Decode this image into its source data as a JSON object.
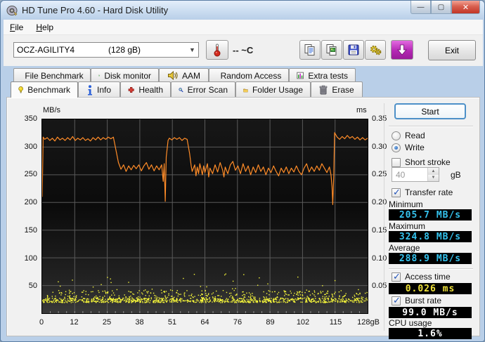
{
  "window": {
    "title": "HD Tune Pro 4.60 - Hard Disk Utility",
    "controls": {
      "minimize": "—",
      "maximize": "▢",
      "close": "✕"
    }
  },
  "menu": {
    "file": "File",
    "help": "Help"
  },
  "toolbar": {
    "drive_selector": {
      "name": "OCZ-AGILITY4",
      "size": "(128 gB)"
    },
    "temperature": "-- ~C",
    "icons": [
      "thermometer-icon",
      "copy-text-icon",
      "copy-image-icon",
      "save-icon",
      "options-gears-icon",
      "download-icon"
    ],
    "exit_label": "Exit"
  },
  "tabs": {
    "top": [
      {
        "label": "File Benchmark",
        "icon": "file-benchmark-icon"
      },
      {
        "label": "Disk monitor",
        "icon": "disk-monitor-icon"
      },
      {
        "label": "AAM",
        "icon": "speaker-icon"
      },
      {
        "label": "Random Access",
        "icon": "random-access-icon"
      },
      {
        "label": "Extra tests",
        "icon": "extra-tests-icon"
      }
    ],
    "bottom": [
      {
        "label": "Benchmark",
        "icon": "lightbulb-icon",
        "active": true
      },
      {
        "label": "Info",
        "icon": "info-icon",
        "active": false
      },
      {
        "label": "Health",
        "icon": "health-cross-icon",
        "active": false
      },
      {
        "label": "Error Scan",
        "icon": "magnifier-icon",
        "active": false
      },
      {
        "label": "Folder Usage",
        "icon": "folder-icon",
        "active": false
      },
      {
        "label": "Erase",
        "icon": "trash-icon",
        "active": false
      }
    ]
  },
  "benchmark_panel": {
    "start_label": "Start",
    "mode": {
      "read_label": "Read",
      "write_label": "Write",
      "selected": "Write"
    },
    "short_stroke": {
      "label": "Short stroke",
      "checked": false,
      "size_value": "40",
      "size_unit": "gB"
    },
    "transfer_rate": {
      "label": "Transfer rate",
      "checked": true,
      "minimum_label": "Minimum",
      "minimum_value": "205.7 MB/s",
      "maximum_label": "Maximum",
      "maximum_value": "324.8 MB/s",
      "average_label": "Average",
      "average_value": "288.9 MB/s"
    },
    "access_time": {
      "label": "Access time",
      "checked": true,
      "value": "0.026 ms"
    },
    "burst_rate": {
      "label": "Burst rate",
      "checked": true,
      "value": "99.0 MB/s"
    },
    "cpu_usage": {
      "label": "CPU usage",
      "value": "1.6%"
    }
  },
  "chart_data": {
    "type": "line",
    "title": "",
    "x_axis": {
      "range": [
        0,
        128
      ],
      "tick_labels": [
        "0",
        "12",
        "25",
        "38",
        "51",
        "64",
        "76",
        "89",
        "102",
        "115",
        "128gB"
      ],
      "grid": true
    },
    "y_left": {
      "label": "MB/s",
      "range": [
        0,
        350
      ],
      "tick_step": 50,
      "grid": true
    },
    "y_right": {
      "label": "ms",
      "range": [
        0,
        0.35
      ],
      "tick_step": 0.05
    },
    "colors": {
      "transfer_line": "#ff8c28",
      "access_dots": "#f8f83a",
      "gridline": "#5a5a5a"
    },
    "series": [
      {
        "name": "transfer-rate-write",
        "unit": "MB/s",
        "points": [
          [
            0,
            210
          ],
          [
            0.4,
            318
          ],
          [
            1,
            314
          ],
          [
            2,
            317
          ],
          [
            3,
            312
          ],
          [
            4,
            316
          ],
          [
            5,
            311
          ],
          [
            6,
            318
          ],
          [
            7,
            313
          ],
          [
            8,
            316
          ],
          [
            9,
            312
          ],
          [
            10,
            317
          ],
          [
            11,
            313
          ],
          [
            12,
            319
          ],
          [
            13,
            312
          ],
          [
            14,
            316
          ],
          [
            15,
            313
          ],
          [
            16,
            317
          ],
          [
            17,
            312
          ],
          [
            18,
            315
          ],
          [
            19,
            311
          ],
          [
            20,
            317
          ],
          [
            21,
            313
          ],
          [
            22,
            318
          ],
          [
            23,
            313
          ],
          [
            24,
            317
          ],
          [
            25,
            314
          ],
          [
            26,
            318
          ],
          [
            27,
            315
          ],
          [
            28,
            318
          ],
          [
            29,
            295
          ],
          [
            30,
            272
          ],
          [
            31,
            260
          ],
          [
            32,
            268
          ],
          [
            33,
            256
          ],
          [
            34,
            266
          ],
          [
            35,
            259
          ],
          [
            36,
            267
          ],
          [
            37,
            261
          ],
          [
            38,
            268
          ],
          [
            39,
            257
          ],
          [
            40,
            266
          ],
          [
            41,
            272
          ],
          [
            42,
            260
          ],
          [
            43,
            268
          ],
          [
            44,
            257
          ],
          [
            45,
            266
          ],
          [
            46,
            259
          ],
          [
            47,
            268
          ],
          [
            47.6,
            238
          ],
          [
            48,
            270
          ],
          [
            48.4,
            202
          ],
          [
            48.8,
            282
          ],
          [
            49.5,
            312
          ],
          [
            50,
            316
          ],
          [
            51,
            313
          ],
          [
            52,
            317
          ],
          [
            53,
            314
          ],
          [
            54,
            317
          ],
          [
            55,
            312
          ],
          [
            56,
            316
          ],
          [
            57,
            314
          ],
          [
            58,
            288
          ],
          [
            58.6,
            266
          ],
          [
            59,
            256
          ],
          [
            60,
            268
          ],
          [
            60.5,
            248
          ],
          [
            61,
            264
          ],
          [
            61.5,
            252
          ],
          [
            62,
            270
          ],
          [
            63,
            250
          ],
          [
            63.5,
            266
          ],
          [
            64,
            254
          ],
          [
            65,
            270
          ],
          [
            65.5,
            246
          ],
          [
            66,
            262
          ],
          [
            67,
            252
          ],
          [
            68,
            268
          ],
          [
            69,
            255
          ],
          [
            70,
            272
          ],
          [
            71,
            258
          ],
          [
            71.5,
            246
          ],
          [
            72,
            264
          ],
          [
            73,
            252
          ],
          [
            74,
            268
          ],
          [
            75,
            274
          ],
          [
            76,
            258
          ],
          [
            77,
            266
          ],
          [
            78,
            252
          ],
          [
            79,
            270
          ],
          [
            80,
            256
          ],
          [
            81,
            266
          ],
          [
            82,
            250
          ],
          [
            83,
            264
          ],
          [
            84,
            254
          ],
          [
            85,
            268
          ],
          [
            86,
            256
          ],
          [
            87,
            264
          ],
          [
            88,
            250
          ],
          [
            89,
            262
          ],
          [
            90,
            254
          ],
          [
            91,
            266
          ],
          [
            92,
            256
          ],
          [
            93,
            248
          ],
          [
            94,
            262
          ],
          [
            95,
            254
          ],
          [
            96,
            264
          ],
          [
            97,
            252
          ],
          [
            98,
            262
          ],
          [
            99,
            255
          ],
          [
            100,
            266
          ],
          [
            101,
            256
          ],
          [
            102,
            250
          ],
          [
            103,
            262
          ],
          [
            104,
            270
          ],
          [
            105,
            255
          ],
          [
            106,
            264
          ],
          [
            107,
            256
          ],
          [
            108,
            266
          ],
          [
            109,
            258
          ],
          [
            110,
            270
          ],
          [
            111,
            262
          ],
          [
            112,
            254
          ],
          [
            113,
            264
          ],
          [
            113.6,
            250
          ],
          [
            114,
            228
          ],
          [
            114.3,
            196
          ],
          [
            114.7,
            250
          ],
          [
            115,
            326
          ],
          [
            116,
            318
          ],
          [
            117,
            314
          ],
          [
            118,
            319
          ],
          [
            119,
            315
          ],
          [
            120,
            321
          ],
          [
            121,
            316
          ],
          [
            122,
            319
          ],
          [
            123,
            314
          ],
          [
            124,
            318
          ],
          [
            125,
            313
          ],
          [
            126,
            317
          ],
          [
            127,
            313
          ],
          [
            128,
            316
          ]
        ]
      },
      {
        "name": "access-time-scatter",
        "unit": "ms",
        "style": "scatter",
        "summary": "dense yellow band 0.020-0.035 ms across full disk, sparse outliers up to 0.075 ms",
        "scatter_params": {
          "seed": 1337,
          "bands": [
            {
              "count": 900,
              "y_min": 0.02,
              "y_max": 0.028
            },
            {
              "count": 300,
              "y_min": 0.028,
              "y_max": 0.042
            },
            {
              "count": 34,
              "y_min": 0.042,
              "y_max": 0.075
            }
          ]
        }
      }
    ]
  }
}
